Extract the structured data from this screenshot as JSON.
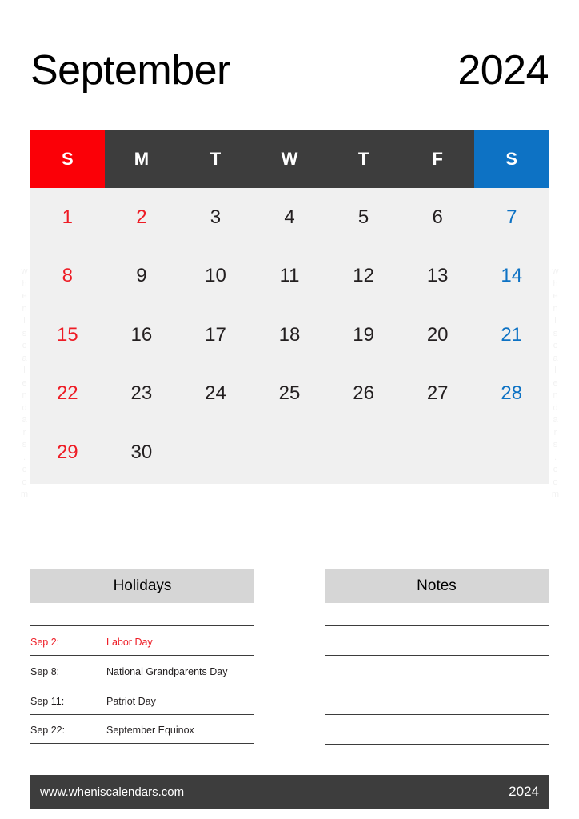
{
  "title": {
    "month": "September",
    "year": "2024"
  },
  "calendar": {
    "weekday_headers": [
      {
        "label": "S",
        "kind": "sunday"
      },
      {
        "label": "M",
        "kind": "weekday"
      },
      {
        "label": "T",
        "kind": "weekday"
      },
      {
        "label": "W",
        "kind": "weekday"
      },
      {
        "label": "T",
        "kind": "weekday"
      },
      {
        "label": "F",
        "kind": "weekday"
      },
      {
        "label": "S",
        "kind": "saturday"
      }
    ],
    "weeks": [
      [
        {
          "day": "1",
          "kind": "sunday"
        },
        {
          "day": "2",
          "kind": "holiday"
        },
        {
          "day": "3",
          "kind": "weekday"
        },
        {
          "day": "4",
          "kind": "weekday"
        },
        {
          "day": "5",
          "kind": "weekday"
        },
        {
          "day": "6",
          "kind": "weekday"
        },
        {
          "day": "7",
          "kind": "saturday"
        }
      ],
      [
        {
          "day": "8",
          "kind": "sunday"
        },
        {
          "day": "9",
          "kind": "weekday"
        },
        {
          "day": "10",
          "kind": "weekday"
        },
        {
          "day": "11",
          "kind": "weekday"
        },
        {
          "day": "12",
          "kind": "weekday"
        },
        {
          "day": "13",
          "kind": "weekday"
        },
        {
          "day": "14",
          "kind": "saturday"
        }
      ],
      [
        {
          "day": "15",
          "kind": "sunday"
        },
        {
          "day": "16",
          "kind": "weekday"
        },
        {
          "day": "17",
          "kind": "weekday"
        },
        {
          "day": "18",
          "kind": "weekday"
        },
        {
          "day": "19",
          "kind": "weekday"
        },
        {
          "day": "20",
          "kind": "weekday"
        },
        {
          "day": "21",
          "kind": "saturday"
        }
      ],
      [
        {
          "day": "22",
          "kind": "sunday"
        },
        {
          "day": "23",
          "kind": "weekday"
        },
        {
          "day": "24",
          "kind": "weekday"
        },
        {
          "day": "25",
          "kind": "weekday"
        },
        {
          "day": "26",
          "kind": "weekday"
        },
        {
          "day": "27",
          "kind": "weekday"
        },
        {
          "day": "28",
          "kind": "saturday"
        }
      ],
      [
        {
          "day": "29",
          "kind": "sunday"
        },
        {
          "day": "30",
          "kind": "weekday"
        },
        {
          "day": "",
          "kind": "empty"
        },
        {
          "day": "",
          "kind": "empty"
        },
        {
          "day": "",
          "kind": "empty"
        },
        {
          "day": "",
          "kind": "empty"
        },
        {
          "day": "",
          "kind": "empty"
        }
      ]
    ]
  },
  "holidays_panel": {
    "heading": "Holidays",
    "rows": [
      {
        "date": "Sep 2:",
        "name": "Labor Day",
        "highlight": true
      },
      {
        "date": "Sep 8:",
        "name": "National Grandparents Day",
        "highlight": false
      },
      {
        "date": "Sep 11:",
        "name": "Patriot Day",
        "highlight": false
      },
      {
        "date": "Sep 22:",
        "name": "September Equinox",
        "highlight": false
      }
    ]
  },
  "notes_panel": {
    "heading": "Notes",
    "line_count": 5
  },
  "footer": {
    "url": "www.wheniscalendars.com",
    "year": "2024"
  },
  "watermark": {
    "text": "wheniscalendars.com"
  },
  "colors": {
    "sunday_header": "#fb0007",
    "saturday_header": "#0d72c4",
    "weekday_header": "#3d3d3d",
    "grid_background": "#f0f0f0",
    "panel_heading": "#d6d6d6",
    "footer": "#3d3d3d",
    "holiday_text": "#ee1c25",
    "saturday_text": "#0d72c4"
  }
}
